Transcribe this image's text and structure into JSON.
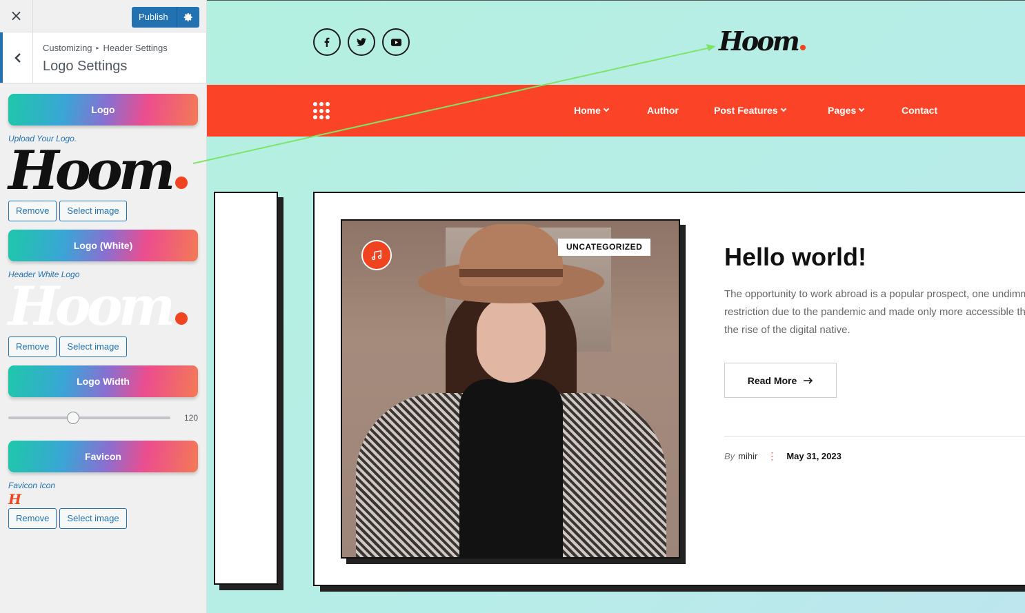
{
  "customizer": {
    "close_label": "×",
    "publish_label": "Publish",
    "breadcrumb": {
      "root": "Customizing",
      "separator": "▸",
      "parent": "Header Settings"
    },
    "section_title": "Logo Settings",
    "controls": {
      "logo": {
        "heading": "Logo",
        "description": "Upload Your Logo.",
        "remove": "Remove",
        "select": "Select image"
      },
      "logo_white": {
        "heading": "Logo (White)",
        "description": "Header White Logo",
        "remove": "Remove",
        "select": "Select image"
      },
      "logo_width": {
        "heading": "Logo Width",
        "value": 120,
        "value_label": "120",
        "min": 0,
        "max": 300
      },
      "favicon": {
        "heading": "Favicon",
        "description": "Favicon Icon",
        "remove": "Remove",
        "select": "Select image"
      }
    },
    "logo_text": "Hoom",
    "favicon_glyph": "H"
  },
  "site": {
    "logo_text": "Hoom",
    "social": [
      "facebook-icon",
      "twitter-icon",
      "youtube-icon"
    ],
    "nav": [
      {
        "label": "Home",
        "dropdown": true
      },
      {
        "label": "Author",
        "dropdown": false
      },
      {
        "label": "Post Features",
        "dropdown": true
      },
      {
        "label": "Pages",
        "dropdown": true
      },
      {
        "label": "Contact",
        "dropdown": false
      }
    ],
    "post": {
      "category": "UNCATEGORIZED",
      "format_icon": "music-icon",
      "title": "Hello world!",
      "excerpt_lines": [
        "The opportunity to work abroad is a popular prospect, one undimm",
        "restriction due to the pandemic and made only more accessible th",
        "the rise of the digital native."
      ],
      "read_more": "Read More",
      "by": "By",
      "author": "mihir",
      "meta_sep": "⋮",
      "date": "May 31, 2023"
    }
  },
  "colors": {
    "accent_blue": "#2271b1",
    "nav_red": "#fb4427",
    "logo_dot": "#f0431f",
    "preview_bg": "#b7ede8",
    "arrow": "#7ee36a"
  }
}
